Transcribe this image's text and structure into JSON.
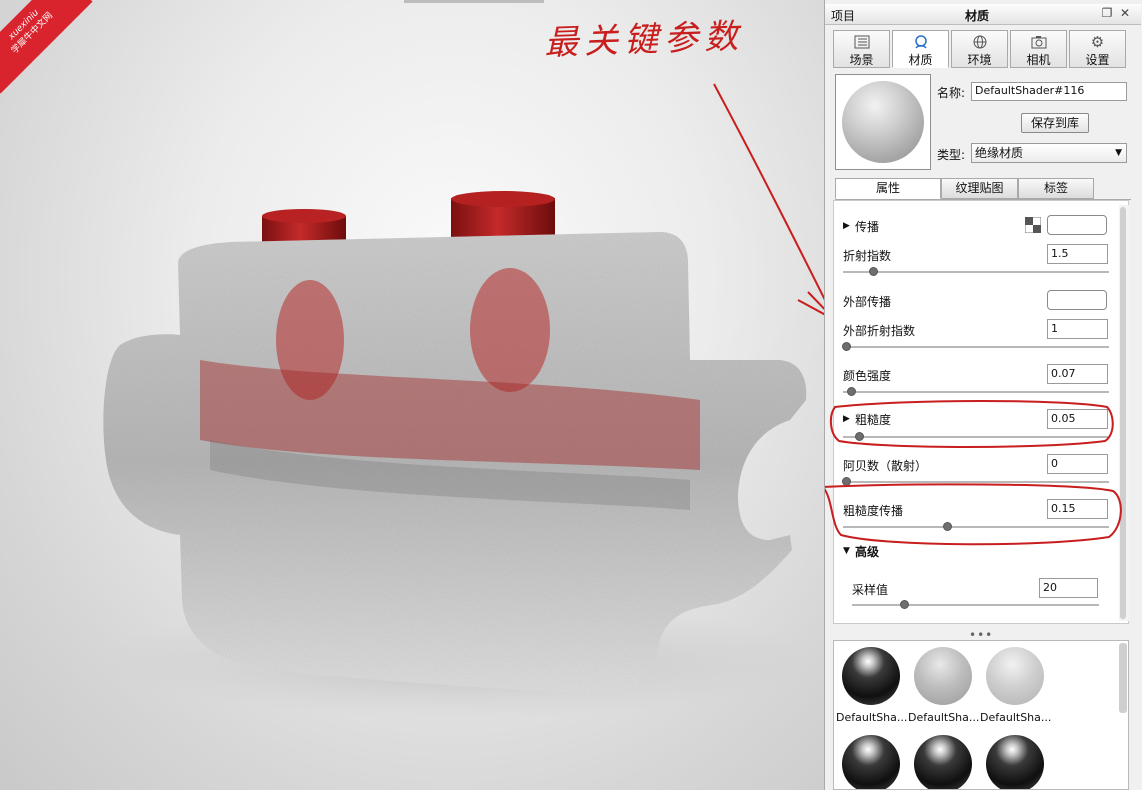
{
  "watermark": {
    "line1": "xuexiniu",
    "line2": "学犀牛中文网"
  },
  "annotation": {
    "text": "最关键参数",
    "color": "#c81e1e"
  },
  "panel": {
    "title_left": "项目",
    "title_center": "材质",
    "tabs": [
      {
        "label": "场景",
        "icon": "list-icon"
      },
      {
        "label": "材质",
        "icon": "material-icon",
        "active": true
      },
      {
        "label": "环境",
        "icon": "globe-icon"
      },
      {
        "label": "相机",
        "icon": "camera-icon"
      },
      {
        "label": "设置",
        "icon": "gear-icon"
      }
    ],
    "name_label": "名称:",
    "name_value": "DefaultShader#116",
    "save_button": "保存到库",
    "type_label": "类型:",
    "type_value": "绝缘材质",
    "subtabs": [
      "属性",
      "纹理贴图",
      "标签"
    ],
    "properties": {
      "transmission": {
        "label": "传播"
      },
      "ior": {
        "label": "折射指数",
        "value": "1.5",
        "slider": 0.1
      },
      "external_transmission": {
        "label": "外部传播"
      },
      "external_ior": {
        "label": "外部折射指数",
        "value": "1",
        "slider": 0.0
      },
      "color_intensity": {
        "label": "颜色强度",
        "value": "0.07",
        "slider": 0.02
      },
      "roughness": {
        "label": "粗糙度",
        "value": "0.05",
        "slider": 0.05
      },
      "abbe": {
        "label": "阿贝数（散射）",
        "value": "0",
        "slider": 0.0
      },
      "roughness_transmission": {
        "label": "粗糙度传播",
        "value": "0.15",
        "slider": 0.38
      },
      "advanced": {
        "label": "高级"
      },
      "samples": {
        "label": "采样值",
        "value": "20",
        "slider": 0.2
      }
    },
    "dots": "•••",
    "library": [
      {
        "name": "DefaultSha...",
        "style": "black"
      },
      {
        "name": "DefaultSha...",
        "style": "grey1"
      },
      {
        "name": "DefaultSha...",
        "style": "grey2"
      },
      {
        "name": "",
        "style": "black"
      },
      {
        "name": "",
        "style": "black"
      },
      {
        "name": "",
        "style": "black"
      }
    ]
  }
}
